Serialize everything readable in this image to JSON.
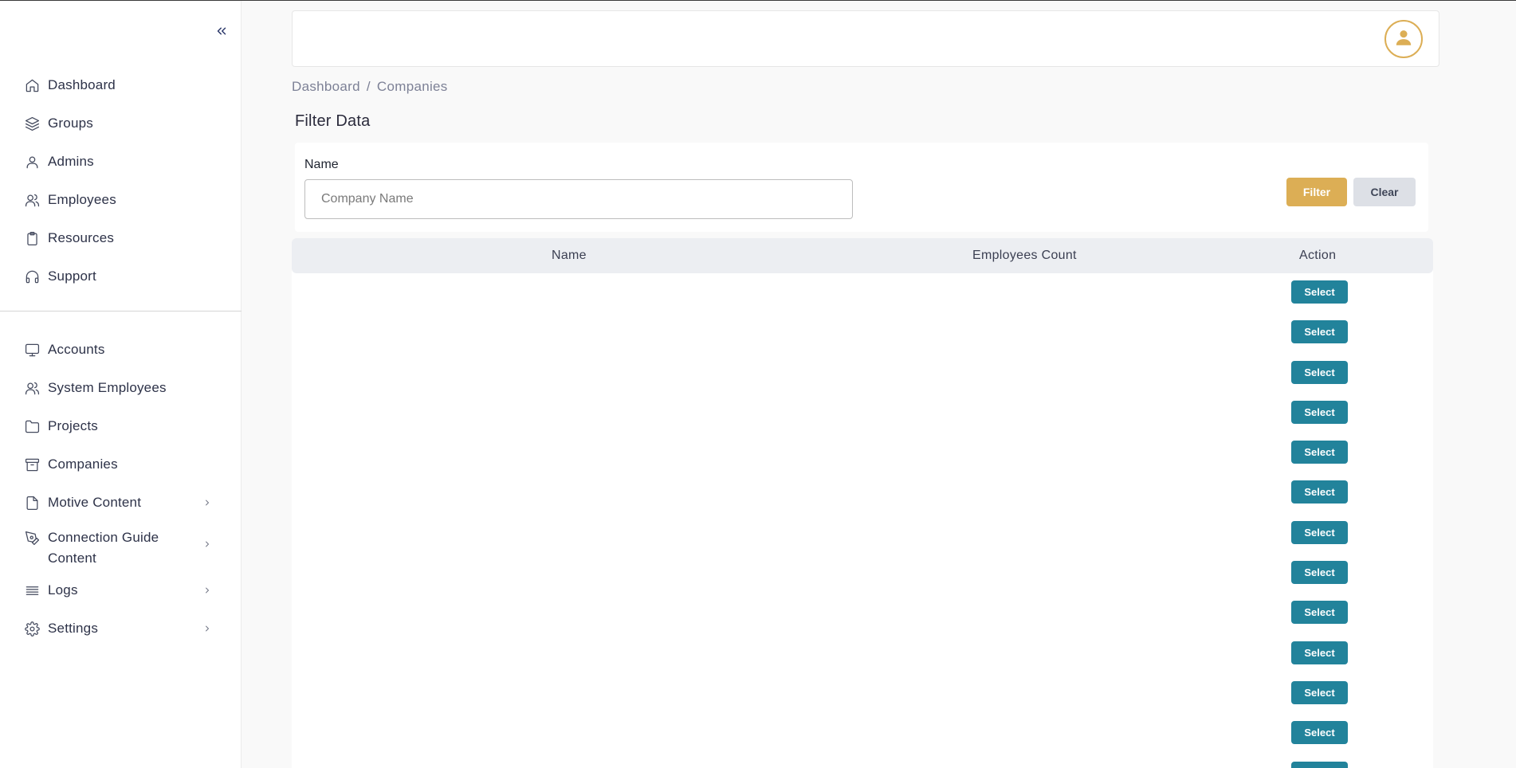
{
  "sidebar": {
    "main_items": [
      {
        "label": "Dashboard",
        "icon": "home-icon"
      },
      {
        "label": "Groups",
        "icon": "layers-icon"
      },
      {
        "label": "Admins",
        "icon": "user-icon"
      },
      {
        "label": "Employees",
        "icon": "users-icon"
      },
      {
        "label": "Resources",
        "icon": "clipboard-icon"
      },
      {
        "label": "Support",
        "icon": "headphones-icon"
      }
    ],
    "secondary_items": [
      {
        "label": "Accounts",
        "icon": "monitor-icon"
      },
      {
        "label": "System Employees",
        "icon": "users-icon"
      },
      {
        "label": "Projects",
        "icon": "folder-icon"
      },
      {
        "label": "Companies",
        "icon": "archive-icon"
      },
      {
        "label": "Motive Content",
        "icon": "file-icon",
        "expandable": true
      },
      {
        "label": "Connection Guide Content",
        "icon": "pen-tool-icon",
        "expandable": true
      },
      {
        "label": "Logs",
        "icon": "list-icon",
        "expandable": true
      },
      {
        "label": "Settings",
        "icon": "settings-icon",
        "expandable": true
      }
    ]
  },
  "breadcrumb": {
    "items": [
      "Dashboard",
      "Companies"
    ],
    "separator": "/"
  },
  "page": {
    "title": "Filter Data"
  },
  "filter": {
    "name_label": "Name",
    "name_value": "",
    "name_placeholder": "Company Name",
    "filter_label": "Filter",
    "clear_label": "Clear"
  },
  "table": {
    "columns": [
      "Name",
      "Employees Count",
      "Action"
    ],
    "select_label": "Select",
    "rows": [
      {
        "name": "",
        "employees_count": ""
      },
      {
        "name": "",
        "employees_count": ""
      },
      {
        "name": "",
        "employees_count": ""
      },
      {
        "name": "",
        "employees_count": ""
      },
      {
        "name": "",
        "employees_count": ""
      },
      {
        "name": "",
        "employees_count": ""
      },
      {
        "name": "",
        "employees_count": ""
      },
      {
        "name": "",
        "employees_count": ""
      },
      {
        "name": "",
        "employees_count": ""
      },
      {
        "name": "",
        "employees_count": ""
      },
      {
        "name": "",
        "employees_count": ""
      },
      {
        "name": "",
        "employees_count": ""
      },
      {
        "name": "",
        "employees_count": ""
      }
    ]
  },
  "colors": {
    "accent": "#dcae55",
    "select_button": "#22839b",
    "clear_button": "#dde0e6",
    "table_header": "#eceef2"
  }
}
